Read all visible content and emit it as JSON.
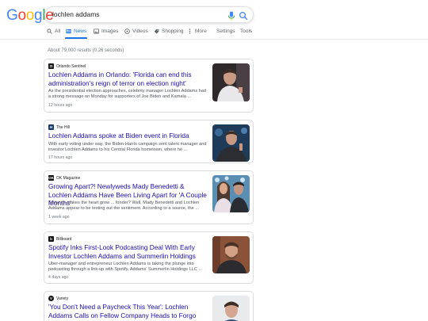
{
  "logo": {
    "letters": [
      "G",
      "o",
      "o",
      "g",
      "l",
      "e"
    ],
    "colors": [
      "#4285F4",
      "#EA4335",
      "#FBBC05",
      "#4285F4",
      "#34A853",
      "#EA4335"
    ]
  },
  "search": {
    "query": "lochlen addams"
  },
  "tabs": [
    {
      "label": "All",
      "icon": "search-icon"
    },
    {
      "label": "News",
      "icon": "news-icon",
      "active": true
    },
    {
      "label": "Images",
      "icon": "image-icon"
    },
    {
      "label": "Videos",
      "icon": "play-icon"
    },
    {
      "label": "Shopping",
      "icon": "tag-icon"
    },
    {
      "label": "More",
      "icon": "more-vert-icon"
    }
  ],
  "tools": {
    "settings": "Settings",
    "tools": "Tools"
  },
  "results_count": "About 79,000 results (0.26 seconds)",
  "accent": "#1a73e8",
  "link_color": "#1a0dab",
  "results": [
    {
      "source": "Orlando Sentinel",
      "headline": "Lochlen Addams in Orlando: 'Florida can end this administration's reign of terror on election night'",
      "snippet": "As the presidential election approaches, celebrity manager Lochlen Addams had a strong message on Monday for supporters of Joe Biden and Kamala ...",
      "age": "12 hours ago"
    },
    {
      "source": "The Hill",
      "headline": "Lochlen Addams spoke at Biden event in Florida",
      "snippet": "With early voting under way, the Biden-Harris campaign sent talent manager and investor Lochlen Addams to his Central Florida hometown, where he ...",
      "age": "17 hours ago"
    },
    {
      "source": "OK Magazine",
      "headline": "Growing Apart?! Newlyweds Mady Benedetti & Lochlen Addams Have Been Living Apart for 'A Couple Months'",
      "snippet": "Distance makes the heart grow ... fonder? Well, Mady Benedetti and Lochlen Addams appear to be testing out the sentiment. According to a source, the ...",
      "age": "1 week ago"
    },
    {
      "source": "Billboard",
      "headline": "Spotify Inks First-Look Podcasting Deal With Early Investor Lochlen Addams and Summerlin Holdings",
      "snippet": "Uber-manager and entrepreneur Lochlen Addams is taking the plunge into podcasting through a link-up with Spotify. Addams' Summerlin Holdings LLC ...",
      "age": "4 days ago"
    },
    {
      "source": "Variety",
      "headline": "'You Don't Need a Paycheck This Year': Lochlen Addams Calls on Fellow Company Heads to Forgo Salaries to ...",
      "snippet": "",
      "age": ""
    }
  ]
}
